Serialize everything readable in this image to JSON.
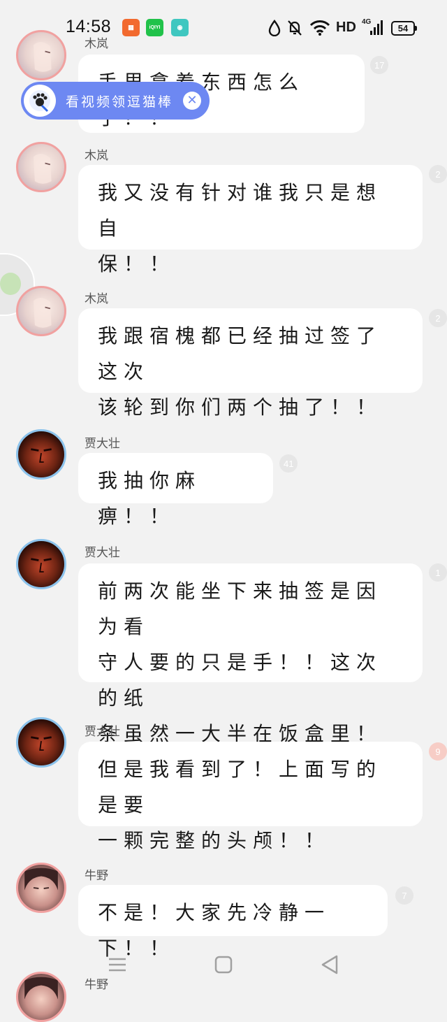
{
  "status_bar": {
    "time": "14:58",
    "network_label": "HD",
    "network_type": "4G",
    "battery": "54"
  },
  "promo": {
    "label": "看视频领逗猫棒",
    "close_icon": "close-icon",
    "accent": "#6d88f2"
  },
  "messages": [
    {
      "sender": "木岚",
      "text": "手里拿着东西怎么了？！",
      "badge": "17"
    },
    {
      "sender": "木岚",
      "text": "我又没有针对谁我只是想自\n保！！",
      "badge": "2"
    },
    {
      "sender": "木岚",
      "text": "我跟宿槐都已经抽过签了这次\n该轮到你们两个抽了！！",
      "badge": "2"
    },
    {
      "sender": "贾大壮",
      "text": "我抽你麻痹！！",
      "badge": "41"
    },
    {
      "sender": "贾大壮",
      "text": "前两次能坐下来抽签是因为看\n守人要的只是手！！这次的纸\n条虽然一大半在饭盒里！",
      "badge": "1"
    },
    {
      "sender": "贾大壮",
      "text": "但是我看到了！上面写的是要\n一颗完整的头颅！！",
      "badge": "9"
    },
    {
      "sender": "牛野",
      "text": "不是！大家先冷静一下！！",
      "badge": "7"
    },
    {
      "sender": "牛野"
    }
  ],
  "navbar": {
    "menu_icon": "menu-icon",
    "home_icon": "home-icon",
    "back_icon": "back-icon"
  }
}
